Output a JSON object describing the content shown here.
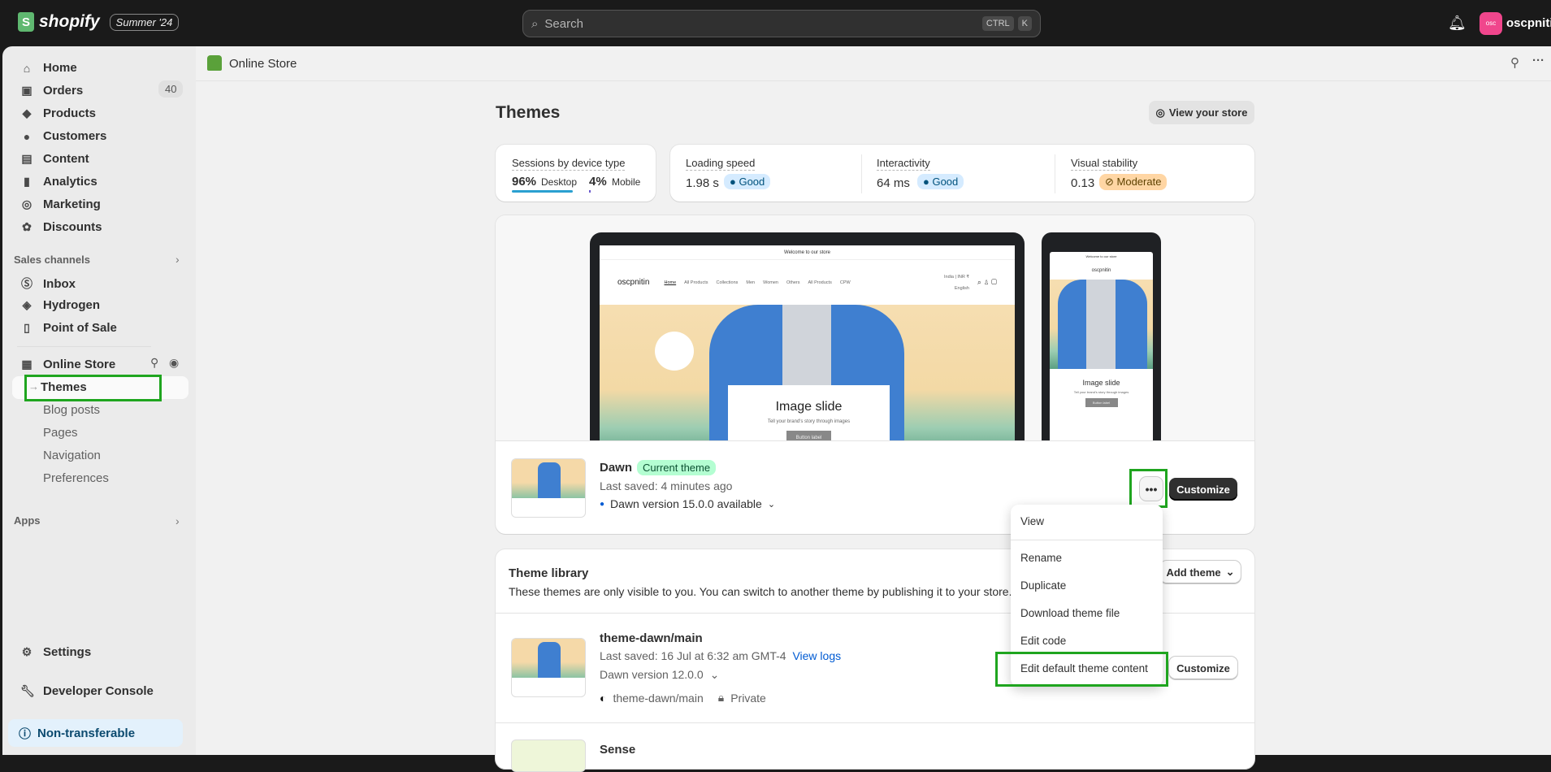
{
  "topbar": {
    "logo": "shopify",
    "edition": "Summer '24",
    "search_placeholder": "Search",
    "kbd1": "CTRL",
    "kbd2": "K",
    "avatar_initials": "osc",
    "username": "oscpnitin"
  },
  "sidebar": {
    "items": [
      {
        "label": "Home",
        "icon": "home-icon"
      },
      {
        "label": "Orders",
        "icon": "inbox-icon",
        "badge": "40"
      },
      {
        "label": "Products",
        "icon": "tag-icon"
      },
      {
        "label": "Customers",
        "icon": "person-icon"
      },
      {
        "label": "Content",
        "icon": "image-icon"
      },
      {
        "label": "Analytics",
        "icon": "bar-chart-icon"
      },
      {
        "label": "Marketing",
        "icon": "target-icon"
      },
      {
        "label": "Discounts",
        "icon": "discount-icon"
      }
    ],
    "sales_channels_label": "Sales channels",
    "channels": [
      {
        "label": "Inbox"
      },
      {
        "label": "Hydrogen"
      },
      {
        "label": "Point of Sale"
      }
    ],
    "online_store": "Online Store",
    "online_store_sub": [
      {
        "label": "Themes",
        "active": true
      },
      {
        "label": "Blog posts"
      },
      {
        "label": "Pages"
      },
      {
        "label": "Navigation"
      },
      {
        "label": "Preferences"
      }
    ],
    "apps_label": "Apps",
    "settings": "Settings",
    "developer_console": "Developer Console",
    "non_transferable": "Non-transferable"
  },
  "breadcrumb": "Online Store",
  "page": {
    "title": "Themes",
    "view_store": "View your store"
  },
  "metrics": {
    "sessions_label": "Sessions by device type",
    "desktop_pct": "96%",
    "desktop_label": "Desktop",
    "mobile_pct": "4%",
    "mobile_label": "Mobile",
    "desktop_share": 96,
    "loading_label": "Loading speed",
    "loading_value": "1.98 s",
    "loading_status": "Good",
    "interactivity_label": "Interactivity",
    "interactivity_value": "64 ms",
    "interactivity_status": "Good",
    "stability_label": "Visual stability",
    "stability_value": "0.13",
    "stability_status": "Moderate"
  },
  "preview": {
    "announcement": "Welcome to our store",
    "store_name": "oscpnitin",
    "nav": [
      "Home",
      "All Products",
      "Collections",
      "Men",
      "Women",
      "Others",
      "All Products",
      "CPW"
    ],
    "locale": "India | INR ₹",
    "language": "English",
    "slide_title": "Image slide",
    "slide_text": "Tell your brand's story through images",
    "slide_button": "Button label"
  },
  "current_theme": {
    "name": "Dawn",
    "badge": "Current theme",
    "last_saved": "Last saved: 4 minutes ago",
    "version": "Dawn version 15.0.0 available",
    "customize": "Customize"
  },
  "menu": {
    "items": [
      "View",
      "Rename",
      "Duplicate",
      "Download theme file",
      "Edit code",
      "Edit default theme content"
    ]
  },
  "library": {
    "title": "Theme library",
    "description": "These themes are only visible to you. You can switch to another theme by publishing it to your store.",
    "add_theme": "Add theme",
    "themes": [
      {
        "name": "theme-dawn/main",
        "last_saved": "Last saved: 16 Jul at 6:32 am GMT-4",
        "view_logs": "View logs",
        "version": "Dawn version 12.0.0",
        "repo": "theme-dawn/main",
        "visibility": "Private",
        "customize": "Customize"
      },
      {
        "name": "Sense"
      }
    ]
  },
  "colors": {
    "accent_green": "#1fa51f",
    "good_badge": "#d5ebff",
    "moderate_badge": "#ffd6a4",
    "current_badge": "#b4fed2",
    "link": "#005bd3"
  }
}
